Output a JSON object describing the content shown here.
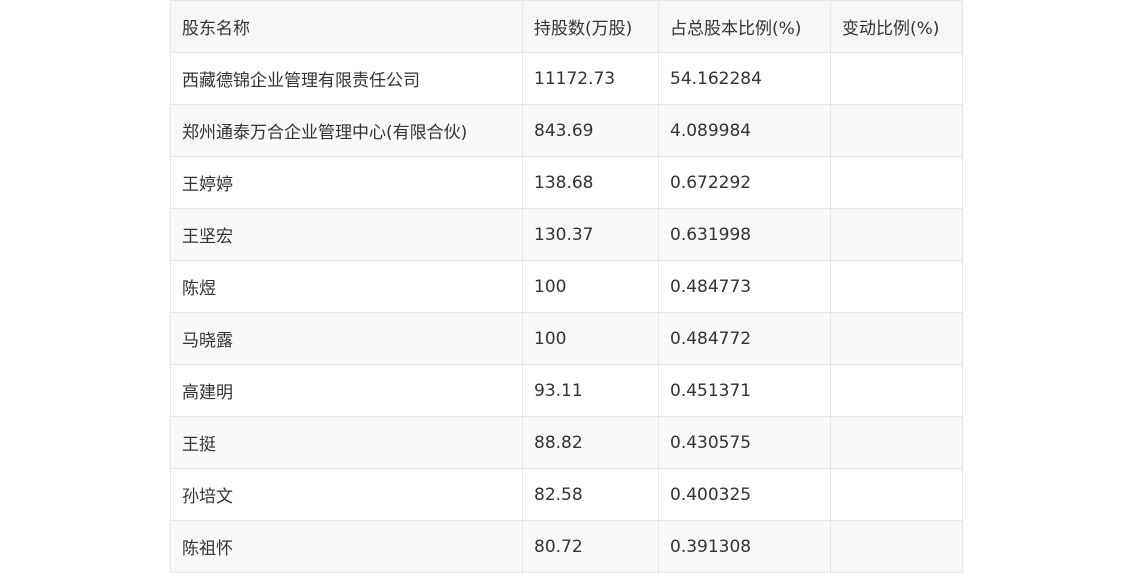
{
  "table": {
    "headers": [
      "股东名称",
      "持股数(万股)",
      "占总股本比例(%)",
      "变动比例(%)"
    ],
    "rows": [
      [
        "西藏德锦企业管理有限责任公司",
        "11172.73",
        "54.162284",
        ""
      ],
      [
        "郑州通泰万合企业管理中心(有限合伙)",
        "843.69",
        "4.089984",
        ""
      ],
      [
        "王婷婷",
        "138.68",
        "0.672292",
        ""
      ],
      [
        "王坚宏",
        "130.37",
        "0.631998",
        ""
      ],
      [
        "陈煜",
        "100",
        "0.484773",
        ""
      ],
      [
        "马晓露",
        "100",
        "0.484772",
        ""
      ],
      [
        "高建明",
        "93.11",
        "0.451371",
        ""
      ],
      [
        "王挺",
        "88.82",
        "0.430575",
        ""
      ],
      [
        "孙培文",
        "82.58",
        "0.400325",
        ""
      ],
      [
        "陈祖怀",
        "80.72",
        "0.391308",
        ""
      ]
    ]
  }
}
